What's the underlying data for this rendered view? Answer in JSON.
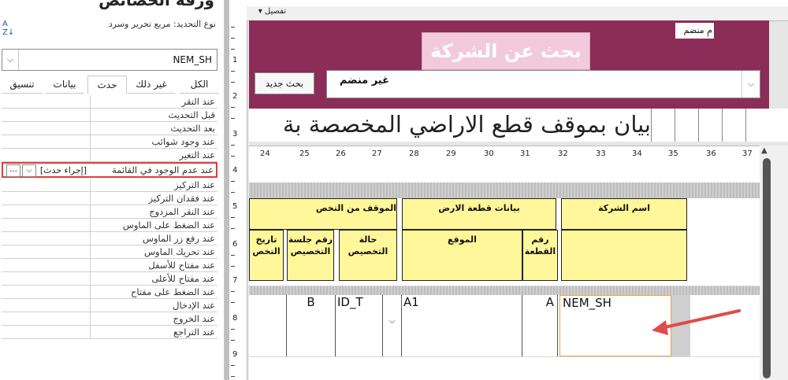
{
  "property_sheet": {
    "title": "ورقة الخصائص",
    "selection_type": "نوع التحديد:  مربع تحرير وسرد",
    "sort_icon_glyph": "A\nZ↓",
    "object_combo_value": "NEM_SH",
    "tabs": [
      {
        "label": "الكل"
      },
      {
        "label": "غير ذلك"
      },
      {
        "label": "حدث"
      },
      {
        "label": "بيانات"
      },
      {
        "label": "تنسيق"
      }
    ],
    "active_tab": "حدث",
    "events": [
      "عند النقر",
      "قبل التحديث",
      "بعد التحديث",
      "عند وجود شوائب",
      "عند التغير",
      "عند عدم الوجود في القائمة",
      "عند التركيز",
      "عند فقدان التركيز",
      "عند النقر المزدوج",
      "عند الضغط على الماوس",
      "عند رفع زر الماوس",
      "عند تحريك الماوس",
      "عند مفتاح للأسفل",
      "عند مفتاح للأعلى",
      "عند الضغط على مفتاح",
      "عند الإدخال",
      "عند الخروج",
      "عند التراجع"
    ],
    "highlighted_event_value": "[إجراء حدث]",
    "build_button": "..."
  },
  "designer": {
    "section_label": "تفصيل",
    "vertical_ruler": [
      "1",
      "2",
      "3",
      "4",
      "5",
      "6",
      "7",
      "8",
      "9"
    ],
    "header": {
      "small_label": "مِ منضم",
      "title": "بحث عن الشركة",
      "search_button": "بحث جديد",
      "search_combo_value": "غير منضم"
    },
    "report_title": "بيان بموقف قطع الاراضي المخصصة بة",
    "horizontal_ruler": [
      "24",
      "25",
      "26",
      "27",
      "28",
      "29",
      "30",
      "31",
      "32",
      "33",
      "34",
      "35",
      "36",
      "37"
    ],
    "column_headers": {
      "company_name": "اسم الشركة",
      "land_data": "بيانات قطعة الارض",
      "allocation_status_group": "الموقف من التخص",
      "plot_number": "رقم القطعة",
      "location": "الموقع",
      "allocation_state": "حالة التخصيص",
      "session_number": "رقم جلسة التخصيص",
      "allocation_date": "تاريخ التخص"
    },
    "detail_fields": {
      "company": "NEM_SH",
      "plot": "A",
      "location": "A1",
      "status": "ID_T",
      "session": "B"
    },
    "colors": {
      "header_bg": "#8b2d58",
      "title_box": "#f3c9dc",
      "label_yellow": "#fff79a",
      "arrow": "#e04a4a",
      "highlight": "#e23b3b"
    }
  }
}
